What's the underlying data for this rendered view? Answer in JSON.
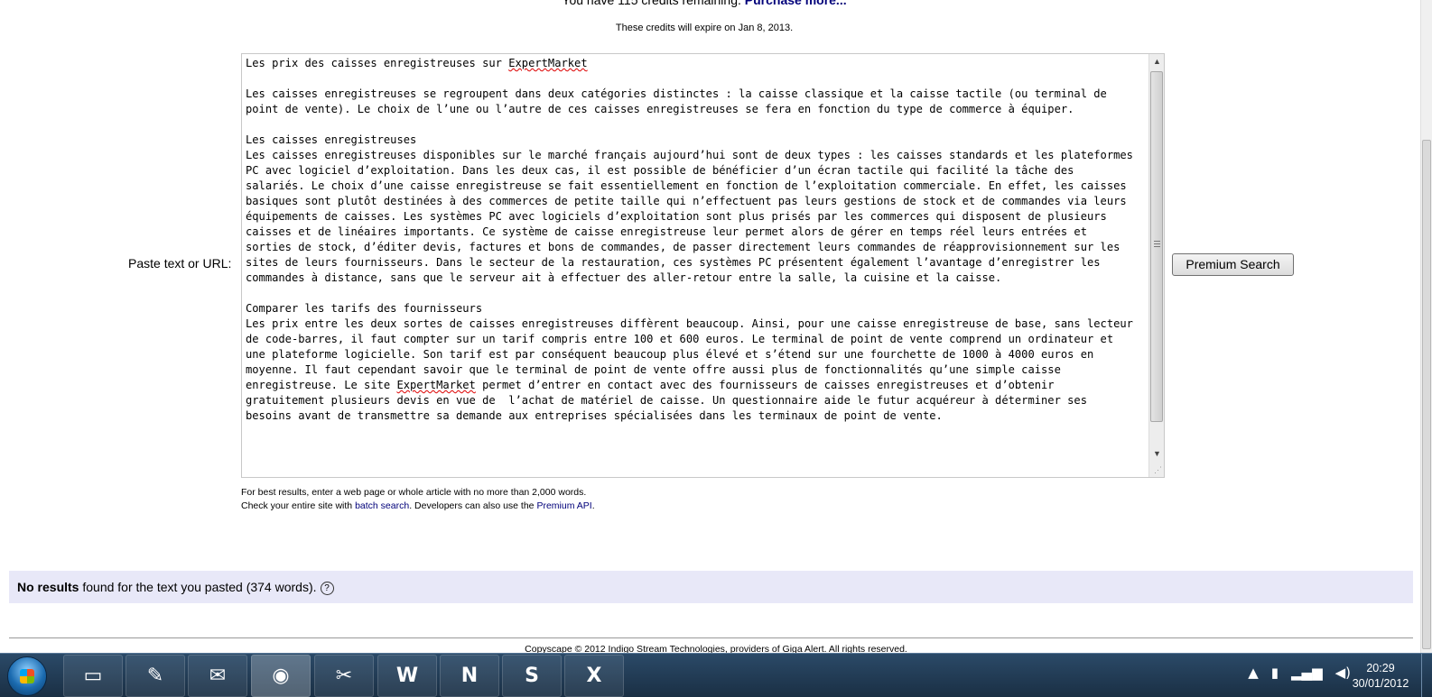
{
  "credits": {
    "prefix": "You have 115 credits remaining.",
    "purchase_link": "Purchase more...",
    "expire": "These credits will expire on Jan 8, 2013."
  },
  "form": {
    "paste_label": "Paste text or URL:",
    "submit_label": "Premium Search",
    "text_title": "Les prix des caisses enregistreuses sur ",
    "text_title_brand": "ExpertMarket",
    "text_body_1": "Les caisses enregistreuses se regroupent dans deux catégories distinctes : la caisse classique et la caisse tactile (ou terminal de point de vente). Le choix de l’une ou l’autre de ces caisses enregistreuses se fera en fonction du type de commerce à équiper.",
    "text_heading_2": "Les caisses enregistreuses",
    "text_body_2": "Les caisses enregistreuses disponibles sur le marché français aujourd’hui sont de deux types : les caisses standards et les plateformes PC avec logiciel d’exploitation. Dans les deux cas, il est possible de bénéficier d’un écran tactile qui facilité la tâche des salariés. Le choix d’une caisse enregistreuse se fait essentiellement en fonction de l’exploitation commerciale. En effet, les caisses basiques sont plutôt destinées à des commerces de petite taille qui n’effectuent pas leurs gestions de stock et de commandes via leurs équipements de caisses. Les systèmes PC avec logiciels d’exploitation sont plus prisés par les commerces qui disposent de plusieurs caisses et de linéaires importants. Ce système de caisse enregistreuse leur permet alors de gérer en temps réel leurs entrées et sorties de stock, d’éditer devis, factures et bons de commandes, de passer directement leurs commandes de réapprovisionnement sur les sites de leurs fournisseurs. Dans le secteur de la restauration, ces systèmes PC présentent également l’avantage d’enregistrer les commandes à distance, sans que le serveur ait à effectuer des aller-retour entre la salle, la cuisine et la caisse.",
    "text_heading_3": "Comparer les tarifs des fournisseurs",
    "text_body_3a": "Les prix entre les deux sortes de caisses enregistreuses diffèrent beaucoup. Ainsi, pour une caisse enregistreuse de base, sans lecteur de code-barres, il faut compter sur un tarif compris entre 100 et 600 euros. Le terminal de point de vente comprend un ordinateur et une plateforme logicielle. Son tarif est par conséquent beaucoup plus élevé et s’étend sur une fourchette de 1000 à 4000 euros en moyenne. Il faut cependant savoir que le terminal de point de vente offre aussi plus de fonctionnalités qu’une simple caisse enregistreuse. Le site ",
    "text_body_3_brand": "ExpertMarket",
    "text_body_3b": " permet d’entrer en contact avec des fournisseurs de caisses enregistreuses et d’obtenir gratuitement plusieurs devis en vue de  l’achat de matériel de caisse. Un questionnaire aide le futur acquéreur à déterminer ses besoins avant de transmettre sa demande aux entreprises spécialisées dans les terminaux de point de vente."
  },
  "hints": {
    "line1": "For best results, enter a web page or whole article with no more than 2,000 words.",
    "line2_prefix": "Check your entire site with ",
    "batch_link": "batch search",
    "line2_mid": ". Developers can also use the ",
    "api_link": "Premium API",
    "line2_suffix": "."
  },
  "result": {
    "bold": "No results",
    "rest": " found for the text you pasted (374 words).",
    "help": "?"
  },
  "footer": {
    "text": "Copyscape © 2012 Indigo Stream Technologies, providers of Giga Alert. All rights reserved."
  },
  "taskbar": {
    "apps": [
      {
        "name": "explorer",
        "glyph": "▭"
      },
      {
        "name": "notepad",
        "glyph": "✎"
      },
      {
        "name": "thunderbird",
        "glyph": "✉"
      },
      {
        "name": "firefox",
        "glyph": "◉"
      },
      {
        "name": "snipping",
        "glyph": "✂"
      },
      {
        "name": "word",
        "glyph": "W"
      },
      {
        "name": "onenote",
        "glyph": "N"
      },
      {
        "name": "skype",
        "glyph": "S"
      },
      {
        "name": "excel",
        "glyph": "X"
      }
    ],
    "time": "20:29",
    "date": "30/01/2012"
  },
  "colors": {
    "link": "#00007a",
    "result_bg": "#e8e8f8"
  }
}
